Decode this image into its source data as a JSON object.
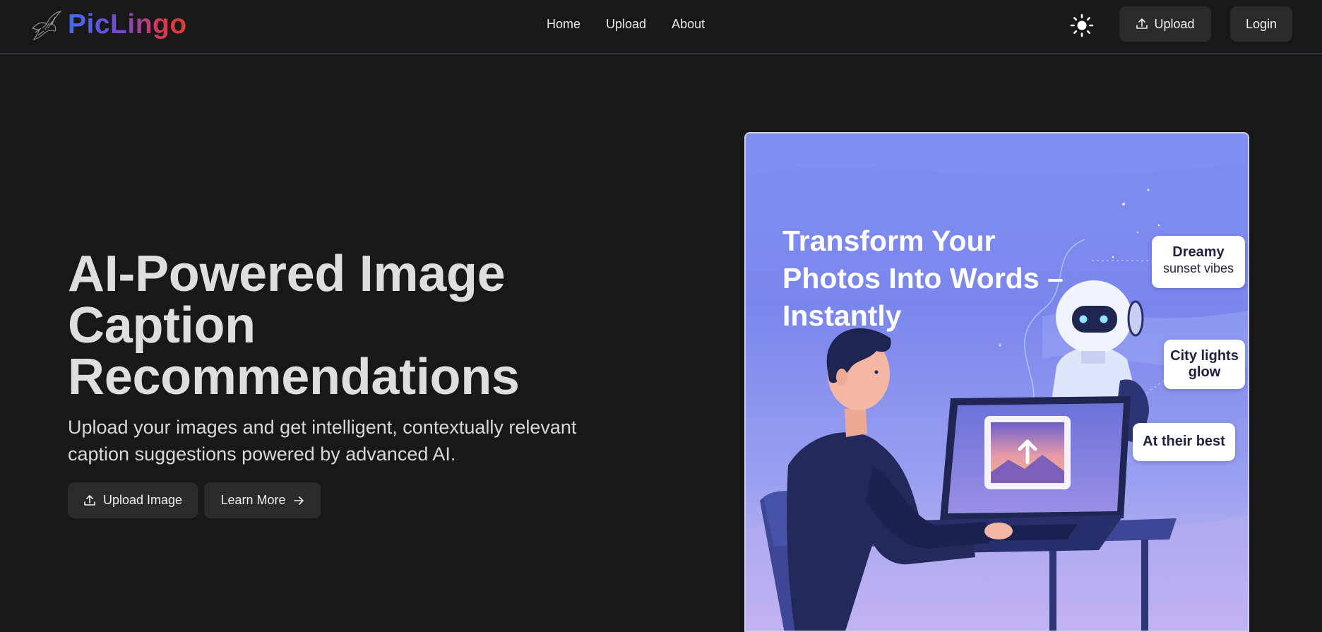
{
  "app": {
    "name": "PicLingo"
  },
  "nav": {
    "items": [
      "Home",
      "Upload",
      "About"
    ]
  },
  "header": {
    "upload_label": "Upload",
    "login_label": "Login"
  },
  "hero": {
    "title": "AI-Powered Image Caption Recommendations",
    "subtitle": "Upload your images and get intelligent, contextually relevant caption suggestions powered by advanced AI.",
    "primary_button": "Upload Image",
    "secondary_button": "Learn More"
  },
  "illustration": {
    "headline": "Transform Your Photos Into Words – Instantly",
    "captions": [
      {
        "line1": "Dreamy",
        "line2": "sunset vibes"
      },
      {
        "line1": "City lights",
        "line2": "glow"
      },
      {
        "line1": "At their best"
      }
    ]
  },
  "colors": {
    "background": "#181818",
    "button": "#2b2b2b",
    "brand_gradient": [
      "#3f6df0",
      "#7a45d6",
      "#e03a2f"
    ]
  }
}
